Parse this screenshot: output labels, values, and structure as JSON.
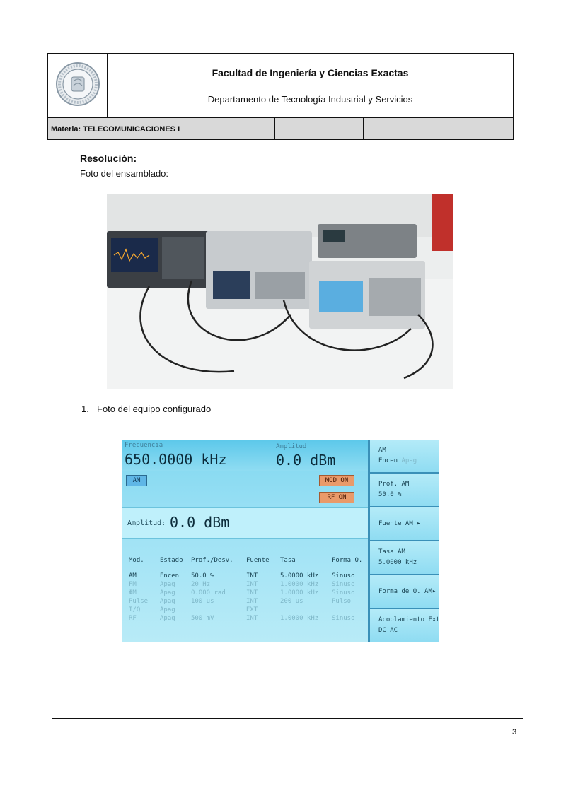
{
  "header": {
    "title": "Facultad de Ingeniería y Ciencias Exactas",
    "subtitle": "Departamento de Tecnología Industrial y Servicios",
    "materia": "Materia: TELECOMUNICACIONES I"
  },
  "body": {
    "resolucion": "Resolución:",
    "foto_ensamblado": "Foto del ensamblado:",
    "list_item_number": "1.",
    "list_item_text": "Foto del equipo configurado"
  },
  "screen": {
    "freq_label": "Frecuencia",
    "freq_value": "650.0000 kHz",
    "amp_label": "Amplitud",
    "amp_value": "0.0 dBm",
    "am_tag": "AM",
    "mod_on": "MOD ON",
    "rf_on": "RF ON",
    "amp_row_label": "Amplitud:",
    "amp_row_value": "0.0 dBm",
    "columns": [
      "Mod.",
      "Estado",
      "Prof./Desv.",
      "Fuente",
      "Tasa",
      "Forma O."
    ],
    "rows": [
      {
        "mod": "AM",
        "estado": "Encen",
        "prof": "50.0 %",
        "fuente": "INT",
        "tasa": "5.0000 kHz",
        "forma": "Sinuso",
        "active": true
      },
      {
        "mod": "FM",
        "estado": "Apag",
        "prof": "20 Hz",
        "fuente": "INT",
        "tasa": "1.0000 kHz",
        "forma": "Sinuso",
        "active": false
      },
      {
        "mod": "ΦM",
        "estado": "Apag",
        "prof": "0.000 rad",
        "fuente": "INT",
        "tasa": "1.0000 kHz",
        "forma": "Sinuso",
        "active": false
      },
      {
        "mod": "Pulse",
        "estado": "Apag",
        "prof": "100 us",
        "fuente": "INT",
        "tasa": "200 us",
        "forma": "Pulso",
        "active": false
      },
      {
        "mod": "I/Q",
        "estado": "Apag",
        "prof": "",
        "fuente": "EXT",
        "tasa": "",
        "forma": "",
        "active": false
      },
      {
        "mod": "RF",
        "estado": "Apag",
        "prof": "500 mV",
        "fuente": "INT",
        "tasa": "1.0000 kHz",
        "forma": "Sinuso",
        "active": false
      }
    ],
    "side": [
      {
        "title": "AM",
        "value": "Encen",
        "value_dim": " Apag"
      },
      {
        "title": "Prof. AM",
        "value": "50.0 %"
      },
      {
        "title": "Fuente AM ▸",
        "value": ""
      },
      {
        "title": "Tasa AM",
        "value": "5.0000 kHz"
      },
      {
        "title": "Forma de O. AM▸",
        "value": ""
      },
      {
        "title": "Acoplamiento Ext",
        "value": "DC    AC"
      }
    ]
  },
  "footer": {
    "page_number": "3"
  }
}
